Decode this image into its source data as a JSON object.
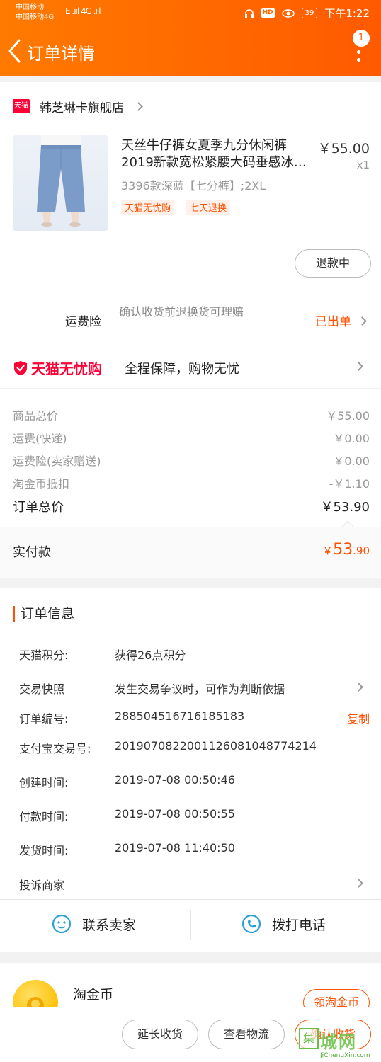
{
  "status_bar": {
    "carrier1": "中国移动",
    "carrier2": "中国移动4G",
    "signal": "E .ııl 4G .ııl",
    "hd": "HD",
    "battery": "39",
    "time": "下午1:22"
  },
  "header": {
    "title": "订单详情",
    "badge_count": "1"
  },
  "shop": {
    "logo_text": "天猫",
    "name": "韩芝琳卡旗舰店"
  },
  "product": {
    "name": "天丝牛仔裤女夏季九分休闲裤2019新款宽松紧腰大码垂感冰…",
    "price": "￥55.00",
    "qty": "x1",
    "spec": "3396款深蓝【七分裤】;2XL",
    "tags": [
      "天猫无忧购",
      "七天退换"
    ],
    "refund_button": "退款中"
  },
  "shipping_insurance": {
    "label": "运费险",
    "desc": "确认收货前退换货可理赔",
    "status": "已出单"
  },
  "wuyou": {
    "logo_text": "天猫无忧购",
    "desc": "全程保障，购物无忧"
  },
  "fees": [
    {
      "label": "商品总价",
      "value": "￥55.00"
    },
    {
      "label": "运费(快递)",
      "value": "￥0.00"
    },
    {
      "label": "运费险(卖家赠送)",
      "value": "￥0.00"
    },
    {
      "label": "淘金币抵扣",
      "value": "-￥1.10"
    }
  ],
  "total": {
    "label": "订单总价",
    "value": "￥53.90"
  },
  "paid": {
    "label": "实付款",
    "currency": "￥",
    "integer": "53",
    "decimal": ".90"
  },
  "order_info": {
    "title": "订单信息",
    "rows": [
      {
        "key": "天猫积分:",
        "value": "获得26点积分"
      },
      {
        "key": "交易快照",
        "value": "发生交易争议时，可作为判断依据"
      },
      {
        "key": "订单编号:",
        "value": "288504516716185183"
      },
      {
        "key": "支付宝交易号:",
        "value": "2019070822001126081048774214"
      },
      {
        "key": "创建时间:",
        "value": "2019-07-08 00:50:46"
      },
      {
        "key": "付款时间:",
        "value": "2019-07-08 00:50:55"
      },
      {
        "key": "发货时间:",
        "value": "2019-07-08 11:40:50"
      },
      {
        "key": "投诉商家",
        "value": ""
      }
    ],
    "copy_label": "复制"
  },
  "contact": {
    "seller_label": "联系卖家",
    "phone_label": "拨打电话"
  },
  "coin": {
    "title": "淘金币",
    "button": "领淘金币"
  },
  "bottom_bar": {
    "extend": "延长收货",
    "logistics": "查看物流",
    "confirm": "确认收货"
  },
  "watermark": {
    "box": "集",
    "big": "城网",
    "url": "JiChengXin.com"
  },
  "colors": {
    "header_start": "#ff7a00",
    "header_end": "#ff5a00",
    "accent": "#ff5000",
    "tmall_red": "#ff0036"
  }
}
